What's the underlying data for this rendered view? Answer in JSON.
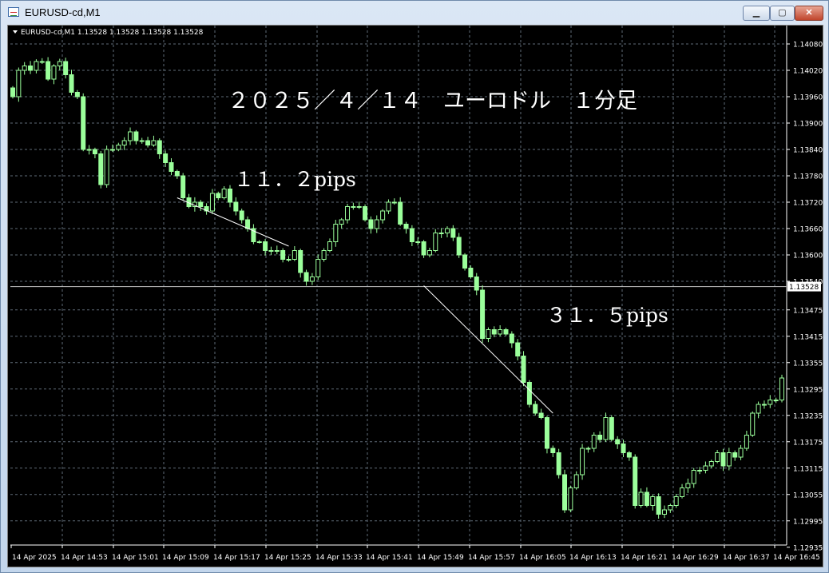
{
  "window": {
    "title": "EURUSD-cd,M1",
    "min_glyph": "▁",
    "max_glyph": "▢",
    "close_glyph": "✕"
  },
  "colors": {
    "background": "#000000",
    "grid": "#5f6b77",
    "candle": "#9bff9b",
    "text": "#ffffff",
    "line": "#ffffff"
  },
  "chart_data": {
    "type": "candlestick",
    "symbol_info": "EURUSD-cd,M1  1.13528 1.13528 1.13528 1.13528",
    "title": "２０２５／４／１４　ユーロドル　１分足",
    "current_price": 1.13528,
    "current_price_label": "1.13528",
    "ylim": [
      1.1294,
      1.141
    ],
    "y_ticks": [
      "1.14080",
      "1.14020",
      "1.13960",
      "1.13900",
      "1.13840",
      "1.13780",
      "1.13720",
      "1.13660",
      "1.13600",
      "1.13540",
      "1.13475",
      "1.13415",
      "1.13355",
      "1.13295",
      "1.13235",
      "1.13175",
      "1.13115",
      "1.13055",
      "1.12995",
      "1.12935"
    ],
    "x_ticks": [
      "14 Apr 2025",
      "14 Apr 14:53",
      "14 Apr 15:01",
      "14 Apr 15:09",
      "14 Apr 15:17",
      "14 Apr 15:25",
      "14 Apr 15:33",
      "14 Apr 15:41",
      "14 Apr 15:49",
      "14 Apr 15:57",
      "14 Apr 16:05",
      "14 Apr 16:13",
      "14 Apr 16:21",
      "14 Apr 16:29",
      "14 Apr 16:37",
      "14 Apr 16:45"
    ],
    "closes": [
      1.1396,
      1.1402,
      1.1403,
      1.1402,
      1.1404,
      1.1404,
      1.14,
      1.1403,
      1.1404,
      1.1401,
      1.1397,
      1.1396,
      1.1384,
      1.1384,
      1.1383,
      1.1376,
      1.1384,
      1.1384,
      1.1385,
      1.1386,
      1.1388,
      1.1386,
      1.1386,
      1.1385,
      1.1386,
      1.1383,
      1.1381,
      1.1379,
      1.1378,
      1.1373,
      1.1371,
      1.1372,
      1.1371,
      1.137,
      1.1374,
      1.1373,
      1.1375,
      1.1372,
      1.137,
      1.1368,
      1.1366,
      1.1363,
      1.1363,
      1.1361,
      1.1361,
      1.1361,
      1.1359,
      1.1359,
      1.1361,
      1.1356,
      1.1354,
      1.1355,
      1.1359,
      1.1361,
      1.1363,
      1.1367,
      1.1368,
      1.1371,
      1.1371,
      1.1371,
      1.1368,
      1.1366,
      1.1368,
      1.137,
      1.1372,
      1.1372,
      1.1367,
      1.1366,
      1.1363,
      1.1363,
      1.136,
      1.1361,
      1.1365,
      1.1365,
      1.1366,
      1.1364,
      1.136,
      1.1357,
      1.1355,
      1.1352,
      1.1341,
      1.1343,
      1.1342,
      1.1343,
      1.1342,
      1.134,
      1.1337,
      1.1331,
      1.1326,
      1.1324,
      1.1323,
      1.1316,
      1.1315,
      1.131,
      1.1302,
      1.1307,
      1.131,
      1.1316,
      1.1316,
      1.1319,
      1.1318,
      1.1323,
      1.1318,
      1.1317,
      1.1315,
      1.1314,
      1.1303,
      1.1306,
      1.1303,
      1.1305,
      1.1301,
      1.1302,
      1.1303,
      1.1305,
      1.1307,
      1.1308,
      1.1311,
      1.1311,
      1.1312,
      1.1313,
      1.1315,
      1.1312,
      1.1315,
      1.1314,
      1.1316,
      1.1319,
      1.1324,
      1.1326,
      1.1326,
      1.1327,
      1.1327,
      1.1332
    ],
    "annotations": [
      {
        "text": "１１．２pips",
        "from": [
          28,
          1.1373
        ],
        "to": [
          47,
          1.1362
        ]
      },
      {
        "text": "３１．５pips",
        "from": [
          70,
          1.1353
        ],
        "to": [
          92,
          1.1324
        ]
      }
    ]
  }
}
